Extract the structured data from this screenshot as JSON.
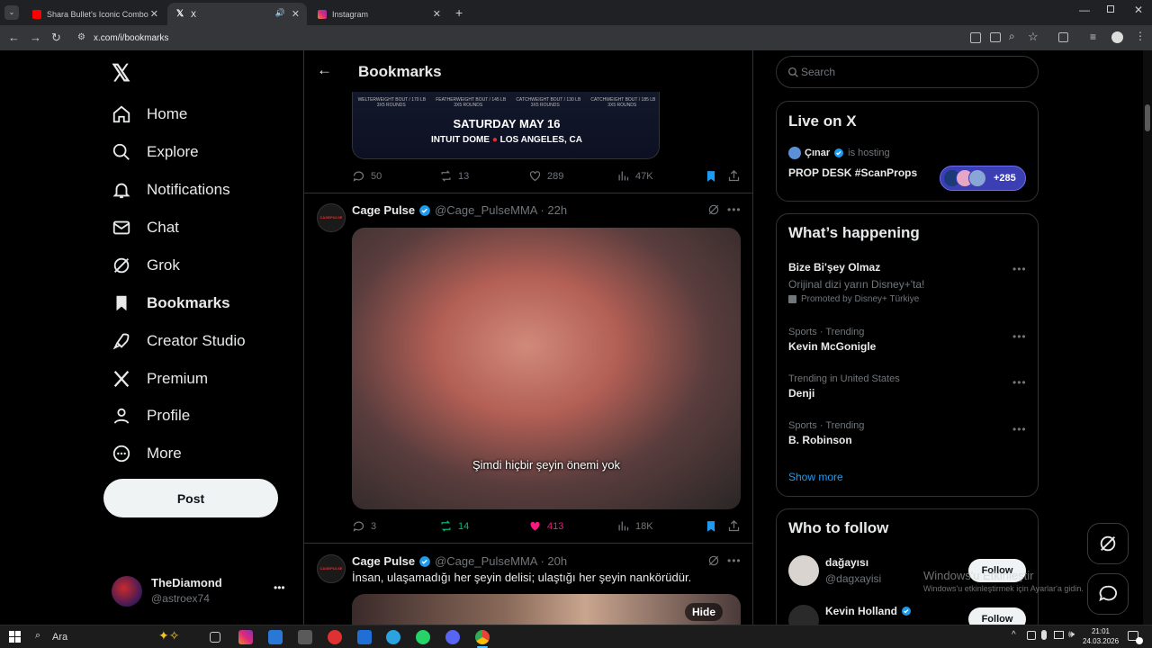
{
  "browser": {
    "tabs": [
      {
        "title": "Shara Bullet's Iconic Combo",
        "color": "#ff0000"
      },
      {
        "title": "X",
        "color": "#ffffff"
      },
      {
        "title": "Instagram",
        "color": "#e1306c"
      }
    ],
    "url": "x.com/i/bookmarks"
  },
  "sidebar": {
    "items": [
      {
        "label": "Home",
        "icon": "home-icon"
      },
      {
        "label": "Explore",
        "icon": "search-icon"
      },
      {
        "label": "Notifications",
        "icon": "bell-icon"
      },
      {
        "label": "Chat",
        "icon": "mail-icon"
      },
      {
        "label": "Grok",
        "icon": "grok-icon"
      },
      {
        "label": "Bookmarks",
        "icon": "bookmark-icon"
      },
      {
        "label": "Creator Studio",
        "icon": "rocket-icon"
      },
      {
        "label": "Premium",
        "icon": "x-logo-icon"
      },
      {
        "label": "Profile",
        "icon": "person-icon"
      },
      {
        "label": "More",
        "icon": "more-circle-icon"
      }
    ],
    "post_label": "Post",
    "account": {
      "name": "TheDiamond",
      "handle": "@astroex74"
    }
  },
  "main": {
    "title": "Bookmarks",
    "event_card": {
      "bouts": [
        "WELTERWEIGHT BOUT / 170 LB",
        "FEATHERWEIGHT BOUT / 145 LB",
        "CATCHWEIGHT BOUT / 130 LB",
        "CATCHWEIGHT BOUT / 185 LB"
      ],
      "rounds": "3X5 ROUNDS",
      "date": "SATURDAY MAY 16",
      "venue": "INTUIT DOME",
      "city": "LOS ANGELES, CA"
    },
    "posts": [
      {
        "replies": "50",
        "reposts": "13",
        "likes": "289",
        "views": "47K"
      },
      {
        "author": "Cage Pulse",
        "handle": "@Cage_PulseMMA",
        "time": "· 22h",
        "avatar_text": "CAGEPULSE",
        "subtitle": "Şimdi hiçbir şeyin önemi yok",
        "replies": "3",
        "reposts": "14",
        "likes": "413",
        "views": "18K"
      },
      {
        "author": "Cage Pulse",
        "handle": "@Cage_PulseMMA",
        "time": "· 20h",
        "avatar_text": "CAGEPULSE",
        "text": "İnsan, ulaşamadığı her şeyin delisi; ulaştığı her şeyin nankörüdür.",
        "hide_label": "Hide"
      }
    ]
  },
  "right": {
    "search_placeholder": "Search",
    "live": {
      "title": "Live on X",
      "host": "Çınar",
      "hosting": "is hosting",
      "space": "PROP DESK #ScanProps",
      "count": "+285"
    },
    "happening": {
      "title": "What’s happening",
      "promo": {
        "title": "Bize Bi'şey Olmaz",
        "desc": "Orijinal dizi yarın Disney+'ta!",
        "promoted": "Promoted by Disney+ Türkiye"
      },
      "trends": [
        {
          "meta": "Sports · Trending",
          "title": "Kevin McGonigle"
        },
        {
          "meta": "Trending in United States",
          "title": "Denji"
        },
        {
          "meta": "Sports · Trending",
          "title": "B. Robinson"
        }
      ],
      "show_more": "Show more"
    },
    "who": {
      "title": "Who to follow",
      "users": [
        {
          "name": "dağayısı",
          "handle": "@dagxayisi",
          "follow": "Follow"
        },
        {
          "name": "Kevin Holland",
          "handle": "",
          "follow": "Follow"
        }
      ]
    },
    "watermark": {
      "line1": "Windows'u Etkinleştir",
      "line2": "Windows'u etkinleştirmek için Ayarlar'a gidin."
    }
  },
  "taskbar": {
    "search": "Ara",
    "time": "21:01",
    "date": "24.03.2026"
  }
}
